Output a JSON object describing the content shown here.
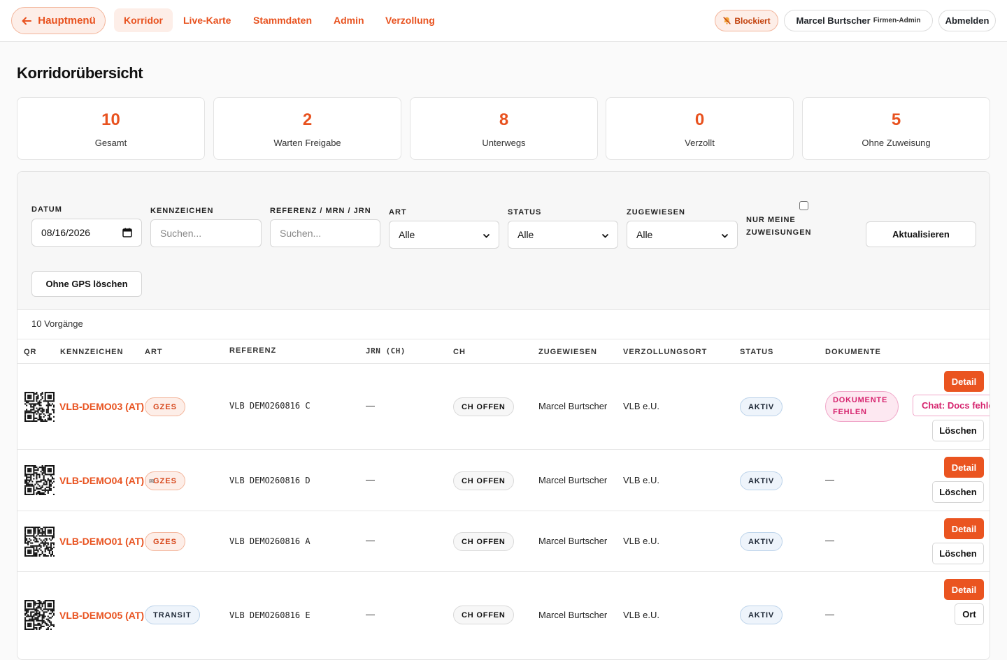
{
  "nav": {
    "back_label": "Hauptmenü",
    "links": [
      "Korridor",
      "Live-Karte",
      "Stammdaten",
      "Admin",
      "Verzollung"
    ],
    "active": "Korridor",
    "blocked_label": "Blockiert",
    "user_name": "Marcel Burtscher",
    "user_role": "Firmen-Admin",
    "logout_label": "Abmelden"
  },
  "page": {
    "title": "Korridorübersicht"
  },
  "stats": [
    {
      "value": "10",
      "label": "Gesamt"
    },
    {
      "value": "2",
      "label": "Warten Freigabe"
    },
    {
      "value": "8",
      "label": "Unterwegs"
    },
    {
      "value": "0",
      "label": "Verzollt"
    },
    {
      "value": "5",
      "label": "Ohne Zuweisung"
    }
  ],
  "filters": {
    "datum_label": "Datum",
    "datum_value": "08/16/2026",
    "kennzeichen_label": "Kennzeichen",
    "kennzeichen_placeholder": "Suchen...",
    "referenz_label": "Referenz / MRN / JRN",
    "referenz_placeholder": "Suchen...",
    "art_label": "Art",
    "art_value": "Alle",
    "status_label": "Status",
    "status_value": "Alle",
    "zugewiesen_label": "Zugewiesen",
    "zugewiesen_value": "Alle",
    "nur_meine_line1": "Nur meine",
    "nur_meine_line2": "Zuweisungen",
    "refresh_label": "Aktualisieren",
    "clear_gps_label": "Ohne GPS löschen"
  },
  "table": {
    "count_label": "10 Vorgänge",
    "columns": {
      "qr": "QR",
      "kennzeichen": "Kennzeichen",
      "art": "Art",
      "referenz": "Referenz",
      "jrn": "JRN (CH)",
      "ch": "CH",
      "zugewiesen": "Zugewiesen",
      "verzollungsort": "Verzollungsort",
      "status": "Status",
      "dokumente": "Dokumente"
    },
    "rows": [
      {
        "plate": "VLB-DEMO03 (AT)",
        "art": "GZES",
        "ref": "VLB DEMO260816 C",
        "jrn": "—",
        "ch": "CH OFFEN",
        "assigned": "Marcel Burtscher",
        "ort": "VLB e.U.",
        "status": "AKTIV",
        "docs_line1": "DOKUMENTE",
        "docs_line2": "FEHLEN",
        "detail": "Detail",
        "chat": "Chat: Docs fehlen",
        "delete": "Löschen"
      },
      {
        "plate": "VLB-DEMO04 (AT)",
        "art": "GZES",
        "ref": "VLB DEMO260816 D",
        "jrn": "—",
        "ch": "CH OFFEN",
        "assigned": "Marcel Burtscher",
        "ort": "VLB e.U.",
        "status": "AKTIV",
        "docs": "—",
        "detail": "Detail",
        "delete": "Löschen"
      },
      {
        "plate": "VLB-DEMO01 (AT)",
        "art": "GZES",
        "ref": "VLB DEMO260816 A",
        "jrn": "—",
        "ch": "CH OFFEN",
        "assigned": "Marcel Burtscher",
        "ort": "VLB e.U.",
        "status": "AKTIV",
        "docs": "—",
        "detail": "Detail",
        "delete": "Löschen"
      },
      {
        "plate": "VLB-DEMO05 (AT)",
        "art": "TRANSIT",
        "ref": "VLB DEMO260816 E",
        "jrn": "—",
        "ch": "CH OFFEN",
        "assigned": "Marcel Burtscher",
        "ort": "VLB e.U.",
        "status": "AKTIV",
        "docs": "—",
        "detail": "Detail",
        "ort_button": "Ort"
      }
    ]
  },
  "colors": {
    "accent": "#e8521f",
    "accent_soft": "#fdeee8",
    "pink": "#d6246e",
    "blue_soft": "#eef4fb"
  },
  "icons": [
    "arrow-left-icon",
    "bell-off-icon",
    "calendar-icon",
    "chevron-down-icon",
    "qr-code-icon"
  ]
}
